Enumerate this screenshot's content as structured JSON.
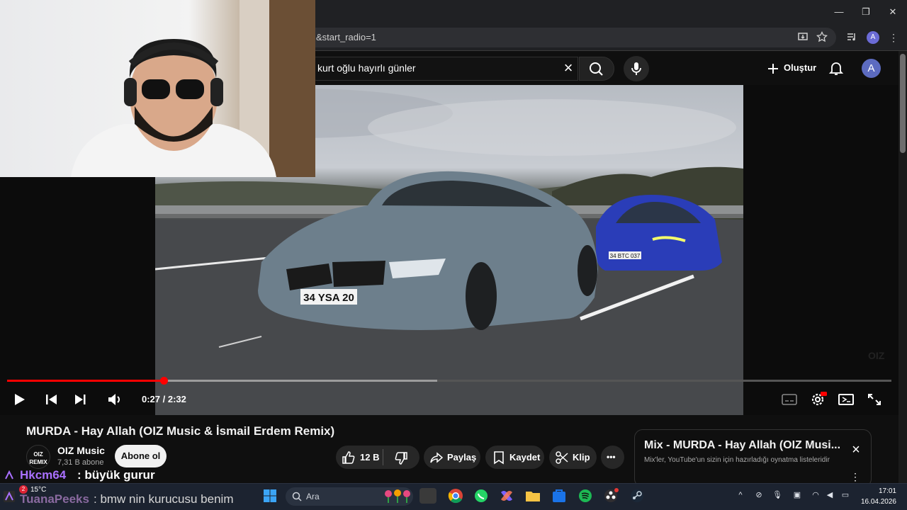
{
  "browser": {
    "url_fragment": "&start_radio=1",
    "profile_initial": "A",
    "window_controls": {
      "minimize": "—",
      "restore": "❐",
      "close": "✕"
    }
  },
  "youtube": {
    "search_query": "kurt oğlu hayırlı günler",
    "create_label": "Oluştur",
    "avatar_initial": "A"
  },
  "player": {
    "time": "0:27 / 2:32",
    "progress_fraction": 0.177,
    "buffered_fraction": 0.486,
    "watermark": "OIZ",
    "plates": {
      "front_car": "34 YSA 20",
      "rear_car": "34 BTC 037"
    }
  },
  "video": {
    "title": "MURDA - Hay Allah (OIZ Music & İsmail Erdem Remix)",
    "channel": {
      "name": "OIZ Music",
      "subscribers": "7,31 B abone",
      "avatar_text": "OIZ REMIX",
      "subscribe_label": "Abone ol"
    },
    "actions": {
      "like_count": "12 B",
      "share_label": "Paylaş",
      "save_label": "Kaydet",
      "clip_label": "Klip",
      "more_label": "•••"
    }
  },
  "mix": {
    "title": "Mix - MURDA - Hay Allah (OIZ Musi...",
    "subtitle": "Mix'ler, YouTube'un sizin için hazırladığı oynatma listeleridir"
  },
  "chat": [
    {
      "user": "Hkcm64",
      "message": ": büyük gurur"
    },
    {
      "user": "TuanaPeeks",
      "message": ": bmw nin kurucusu benim"
    }
  ],
  "taskbar": {
    "weather": "15°C",
    "weather_badge": "2",
    "search_placeholder": "Ara",
    "time": "17:01",
    "date": "16.04.2026"
  },
  "colors": {
    "accent_red": "#ff0000",
    "chat_user": "#a970ff",
    "background": "#0f0f0f"
  }
}
